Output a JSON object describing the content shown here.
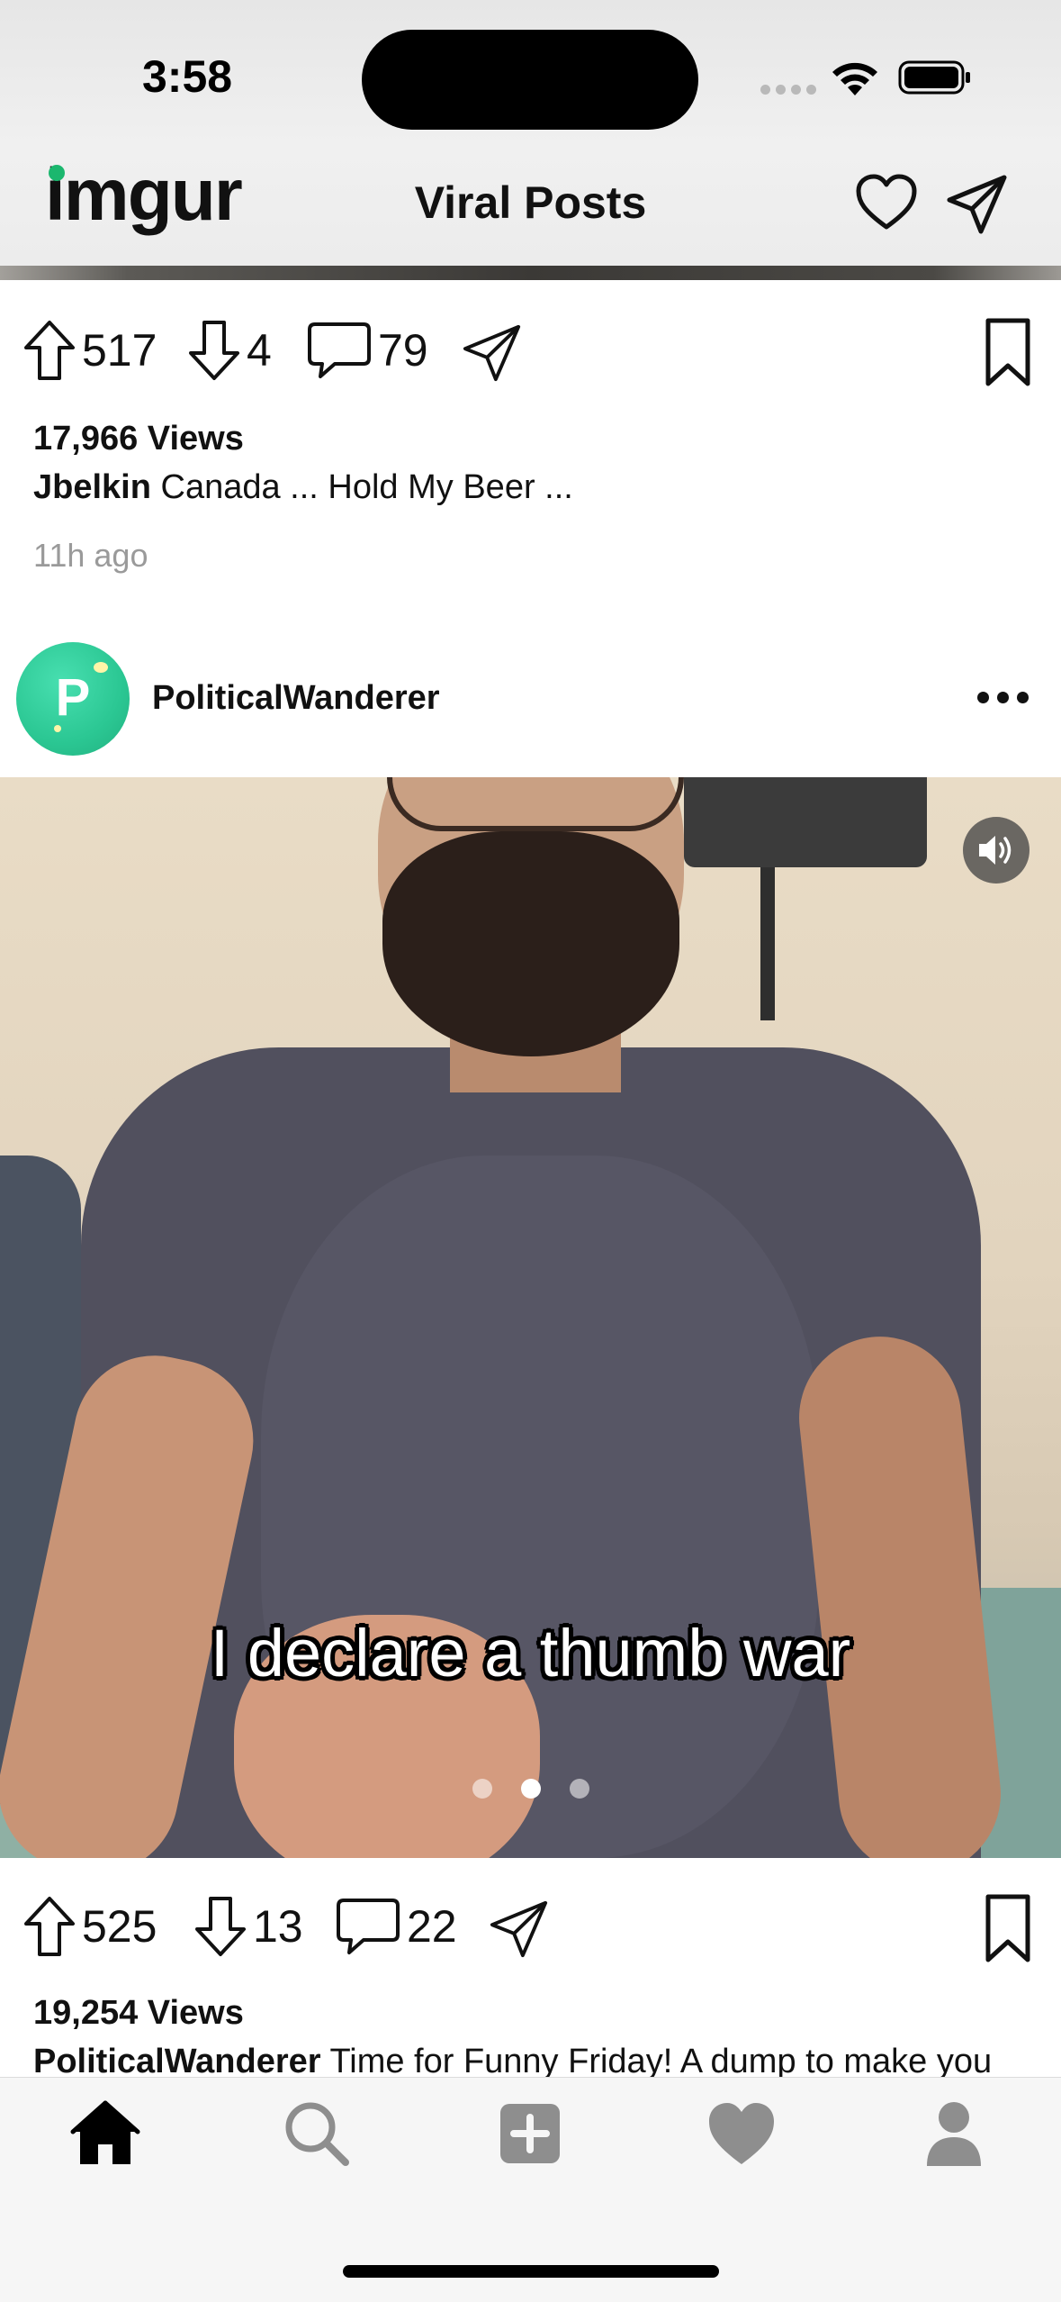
{
  "status_bar": {
    "time": "3:58"
  },
  "header": {
    "logo": "imgur",
    "title": "Viral Posts"
  },
  "post1": {
    "upvotes": "517",
    "downvotes": "4",
    "comments": "79",
    "views": "17,966 Views",
    "author": "Jbelkin",
    "caption": "Canada ... Hold My Beer ...",
    "time_ago": "11h ago"
  },
  "post2": {
    "avatar_letter": "P",
    "author": "PoliticalWanderer",
    "media_subtitle": "I declare a thumb war",
    "carousel": {
      "count": 3,
      "active_index": 1
    },
    "upvotes": "525",
    "downvotes": "13",
    "comments": "22",
    "views": "19,254 Views",
    "caption_author": "PoliticalWanderer",
    "caption": "Time for Funny Friday! A dump to make you"
  },
  "tabbar": {
    "items": [
      "home-icon",
      "search-icon",
      "add-post-icon",
      "favorites-icon",
      "profile-icon"
    ],
    "active": "home-icon"
  }
}
